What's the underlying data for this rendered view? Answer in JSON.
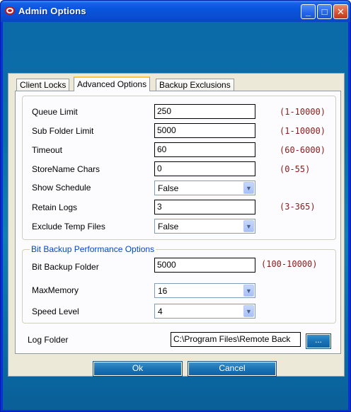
{
  "window": {
    "title": "Admin Options",
    "buttons": {
      "minimize": "_",
      "maximize": "□",
      "close": "✕"
    }
  },
  "tabs": [
    {
      "label": "Client Locks"
    },
    {
      "label": "Advanced Options"
    },
    {
      "label": "Backup Exclusions"
    }
  ],
  "active_tab": "Advanced Options",
  "settings": {
    "queue_limit": {
      "label": "Queue Limit",
      "value": "250",
      "range": "(1-10000)"
    },
    "sub_folder_limit": {
      "label": "Sub Folder Limit",
      "value": "5000",
      "range": "(1-10000)"
    },
    "timeout": {
      "label": "Timeout",
      "value": "60",
      "range": "(60-6000)"
    },
    "storename_chars": {
      "label": "StoreName Chars",
      "value": "0",
      "range": "(0-55)"
    },
    "show_schedule": {
      "label": "Show Schedule",
      "value": "False"
    },
    "retain_logs": {
      "label": "Retain Logs",
      "value": "3",
      "range": "(3-365)"
    },
    "exclude_temp_files": {
      "label": "Exclude Temp Files",
      "value": "False"
    }
  },
  "bit_backup": {
    "legend": "Bit Backup Performance Options",
    "folder": {
      "label": "Bit Backup Folder",
      "value": "5000",
      "range": "(100-10000)"
    },
    "max_memory": {
      "label": "MaxMemory",
      "value": "16"
    },
    "speed_level": {
      "label": "Speed Level",
      "value": "4"
    }
  },
  "log_folder": {
    "label": "Log Folder",
    "value": "C:\\Program Files\\Remote Back",
    "browse_label": "..."
  },
  "footer": {
    "ok_label": "Ok",
    "cancel_label": "Cancel"
  },
  "icons": {
    "app": "app-logo-icon",
    "dropdown": "chevron-down-icon"
  },
  "colors": {
    "title_bar": "#0855dd",
    "range_text": "#8b1a1a",
    "legend_text": "#0046d5",
    "client_bg": "#0a6fa8"
  }
}
